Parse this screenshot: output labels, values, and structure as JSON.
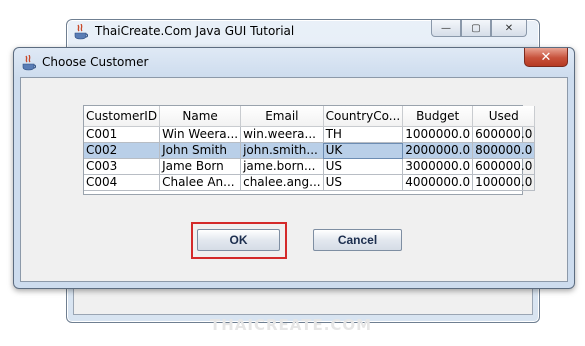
{
  "background_window": {
    "title": "ThaiCreate.Com Java GUI Tutorial",
    "controls": {
      "minimize": "—",
      "maximize": "▢",
      "close": "✕"
    }
  },
  "watermark": "THAICREATE.COM",
  "dialog": {
    "title": "Choose Customer",
    "close_label": "✕",
    "table": {
      "columns": [
        "CustomerID",
        "Name",
        "Email",
        "CountryCo...",
        "Budget",
        "Used"
      ],
      "rows": [
        [
          "C001",
          "Win Weera...",
          "win.weera...",
          "TH",
          "1000000.0",
          "600000.0"
        ],
        [
          "C002",
          "John  Smith",
          "john.smith...",
          "UK",
          "2000000.0",
          "800000.0"
        ],
        [
          "C003",
          "Jame Born",
          "jame.born...",
          "US",
          "3000000.0",
          "600000.0"
        ],
        [
          "C004",
          "Chalee An...",
          "chalee.ang...",
          "US",
          "4000000.0",
          "100000.0"
        ]
      ],
      "selected_row": 1
    },
    "buttons": {
      "ok": "OK",
      "cancel": "Cancel"
    }
  },
  "colors": {
    "selection": "#b9cfe8",
    "highlight_box": "#d42a2a",
    "close_button": "#c7513b"
  }
}
